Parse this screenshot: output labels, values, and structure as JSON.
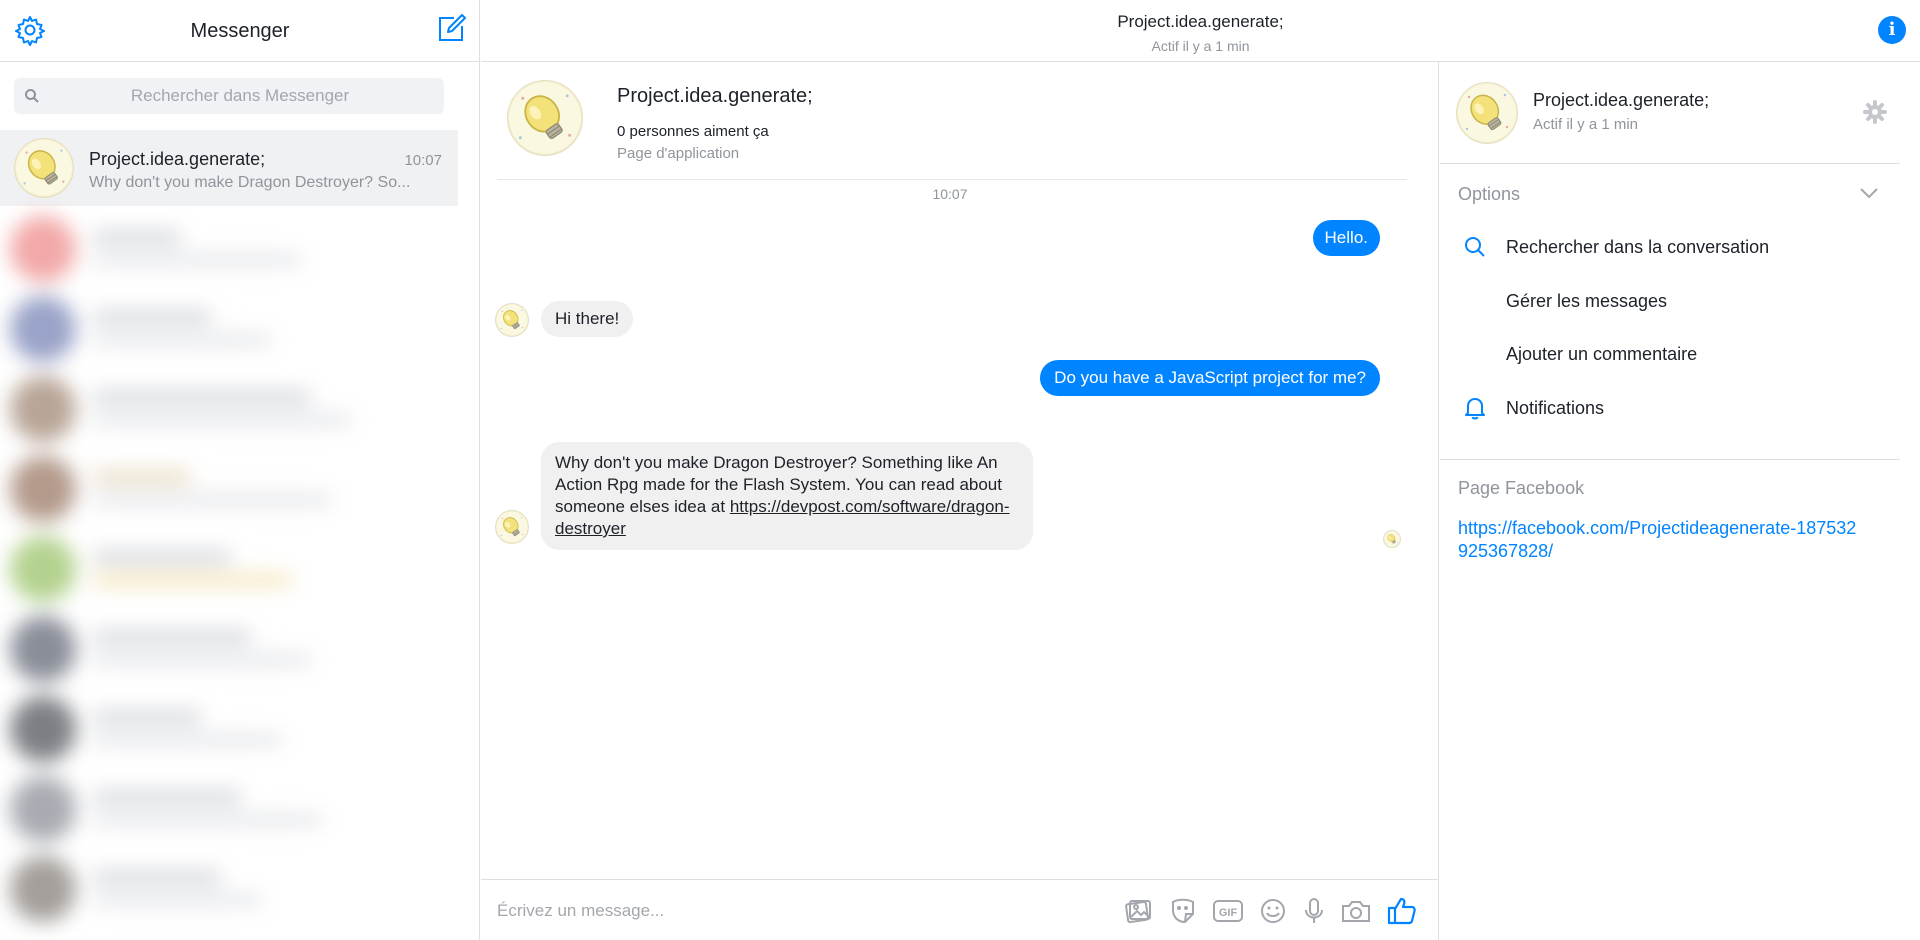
{
  "sidebar": {
    "title": "Messenger",
    "search_placeholder": "Rechercher dans Messenger",
    "active_conversation": {
      "name": "Project.idea.generate;",
      "time": "10:07",
      "preview": "Why don't you make Dragon Destroyer? So..."
    }
  },
  "header": {
    "title": "Project.idea.generate;",
    "status": "Actif il y a 1 min"
  },
  "page_card": {
    "name": "Project.idea.generate;",
    "likes": "0 personnes aiment ça",
    "type": "Page d'application"
  },
  "conversation": {
    "timestamp": "10:07",
    "messages": [
      {
        "from": "me",
        "text": "Hello."
      },
      {
        "from": "page",
        "text": "Hi there!"
      },
      {
        "from": "me",
        "text": "Do you have a JavaScript project for me?"
      },
      {
        "from": "page",
        "text": "Why don't you make Dragon Destroyer? Something like An Action Rpg made for the Flash System. You can read about someone elses idea at ",
        "link": "https://devpost.com/software/dragon-destroyer"
      }
    ]
  },
  "composer": {
    "placeholder": "Écrivez un message...",
    "tools": [
      "photo-icon",
      "sticker-icon",
      "gif-icon",
      "emoji-icon",
      "microphone-icon",
      "camera-icon",
      "thumbs-up-icon"
    ]
  },
  "right_panel": {
    "name": "Project.idea.generate;",
    "status": "Actif il y a 1 min",
    "options_label": "Options",
    "options": [
      {
        "label": "Rechercher dans la conversation",
        "icon": "search-icon"
      },
      {
        "label": "Gérer les messages",
        "icon": ""
      },
      {
        "label": "Ajouter un commentaire",
        "icon": ""
      },
      {
        "label": "Notifications",
        "icon": "bell-icon"
      }
    ],
    "facebook_label": "Page Facebook",
    "facebook_url": "https://facebook.com/Projectideagenerate-187532925367828/"
  },
  "colors": {
    "accent": "#0084ff",
    "outgoing_bubble": "#0084ff",
    "incoming_bubble": "#f1f0f0",
    "muted_text": "#90949c",
    "divider": "#dddfe2"
  }
}
